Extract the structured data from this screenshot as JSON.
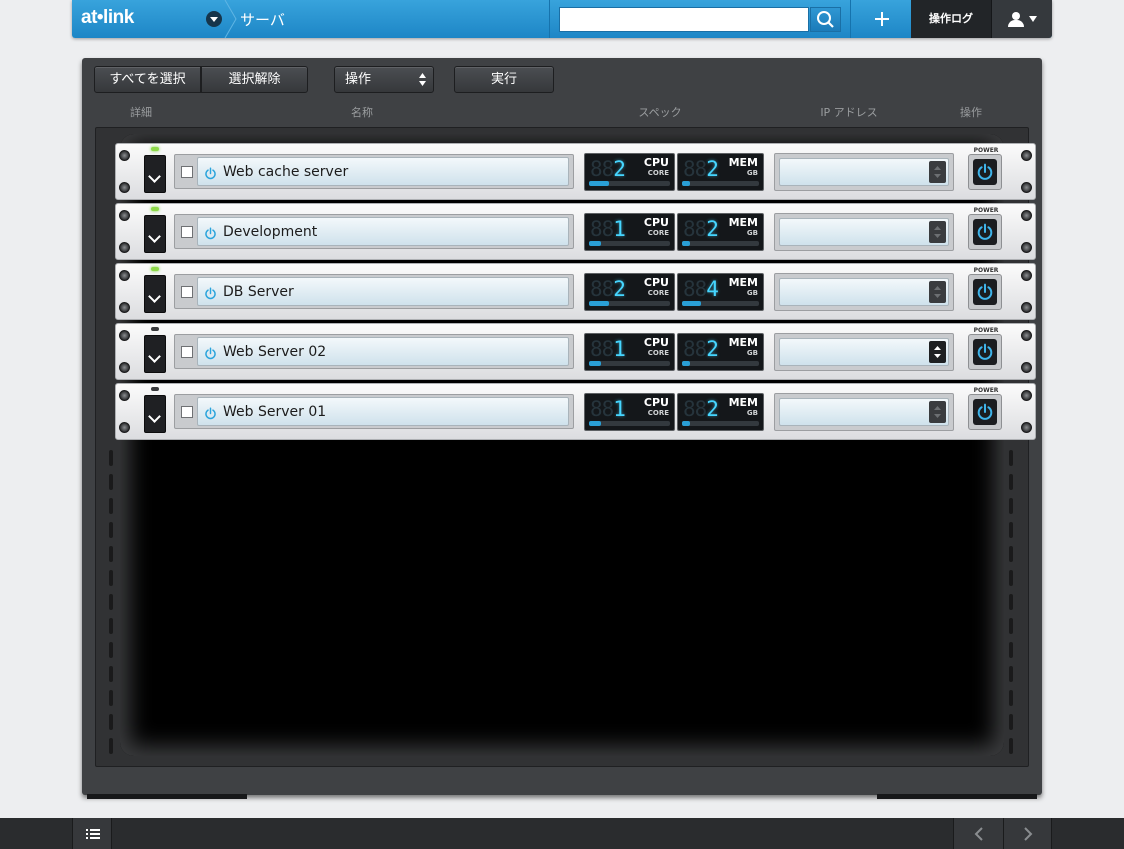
{
  "header": {
    "logo": "at•link",
    "section": "サーバ",
    "search_placeholder": "",
    "oplog_label": "操作ログ",
    "icons": [
      "chevron-down-icon",
      "search-icon",
      "plus-icon",
      "user-icon",
      "caret-down-icon"
    ]
  },
  "toolbar": {
    "select_all": "すべてを選択",
    "deselect": "選択解除",
    "operation_select": "操作",
    "execute": "実行"
  },
  "columns": {
    "detail": "詳細",
    "name": "名称",
    "spec": "スペック",
    "ip": "IP アドレス",
    "operation": "操作"
  },
  "spec_labels": {
    "cpu": "CPU",
    "cpu_unit": "CORE",
    "mem": "MEM",
    "mem_unit": "GB"
  },
  "power_label": "POWER",
  "colors": {
    "header_blue": "#1d86c6",
    "led_on": "#8ed94a",
    "digit_cyan": "#46d6ff",
    "panel_dark": "#3f4144"
  },
  "servers": [
    {
      "name": "Web cache server",
      "cpu": "2",
      "mem": "2",
      "cpu_level": 0.25,
      "mem_level": 0.1,
      "running": true,
      "ip": ""
    },
    {
      "name": "Development",
      "cpu": "1",
      "mem": "2",
      "cpu_level": 0.15,
      "mem_level": 0.1,
      "running": true,
      "ip": ""
    },
    {
      "name": "DB Server",
      "cpu": "2",
      "mem": "4",
      "cpu_level": 0.25,
      "mem_level": 0.25,
      "running": true,
      "ip": ""
    },
    {
      "name": "Web Server 02",
      "cpu": "1",
      "mem": "2",
      "cpu_level": 0.15,
      "mem_level": 0.1,
      "running": false,
      "ip": ""
    },
    {
      "name": "Web Server 01",
      "cpu": "1",
      "mem": "2",
      "cpu_level": 0.15,
      "mem_level": 0.1,
      "running": false,
      "ip": ""
    }
  ]
}
